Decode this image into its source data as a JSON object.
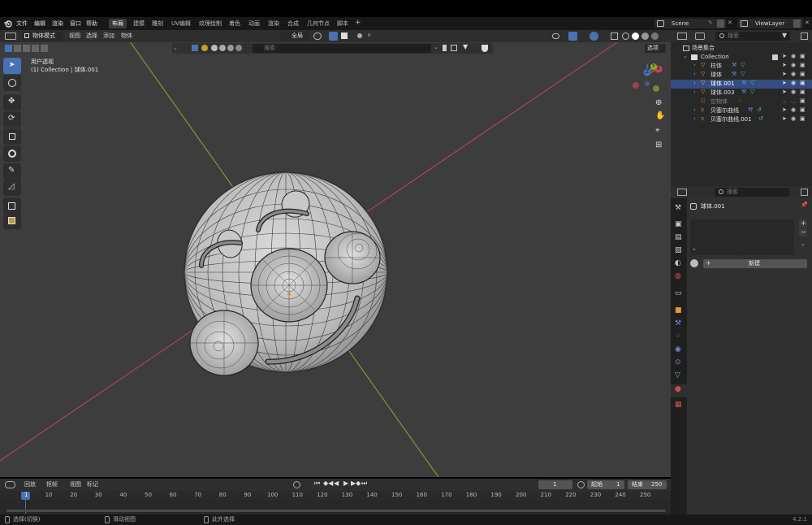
{
  "menu": {
    "items": [
      "文件",
      "编辑",
      "渲染",
      "窗口",
      "帮助"
    ],
    "workspaces": [
      "布局",
      "建模",
      "雕刻",
      "UV编辑",
      "纹理绘制",
      "着色",
      "动画",
      "渲染",
      "合成",
      "几何节点",
      "脚本"
    ],
    "active_workspace": "布局",
    "add_tab": "+",
    "scene": "Scene",
    "view_layer": "ViewLayer"
  },
  "viewport": {
    "mode": "物体模式",
    "menus": [
      "视图",
      "选择",
      "添加",
      "物体"
    ],
    "transform_orientation": "全局",
    "search_placeholder": "搜索",
    "options_label": "选项",
    "view_label": "用户透视",
    "collection_label": "(1) Collection | 球体.001",
    "gizmo": {
      "x": "X",
      "y": "Y",
      "z": "Z"
    },
    "colors": {
      "x_axis": "#c04858",
      "y_axis": "#8fa632",
      "active": "#4772b3"
    }
  },
  "outliner": {
    "search_placeholder": "搜索",
    "root": "场景集合",
    "collection": "Collection",
    "items": [
      {
        "name": "柱体",
        "selected": false
      },
      {
        "name": "球体",
        "selected": false
      },
      {
        "name": "球体.001",
        "selected": true
      },
      {
        "name": "球体.003",
        "selected": false
      },
      {
        "name": "空物体",
        "selected": false
      },
      {
        "name": "贝塞尔曲线",
        "selected": false
      },
      {
        "name": "贝塞尔曲线.001",
        "selected": false
      }
    ]
  },
  "properties": {
    "search_placeholder": "搜索",
    "object_name": "球体.001",
    "new_button": "新建",
    "plus_icon": "+",
    "minus_icon": "−"
  },
  "timeline": {
    "menus": [
      "回放",
      "抠帧",
      "视图",
      "标记"
    ],
    "current_frame": "1",
    "start_label": "起始",
    "start_value": "1",
    "end_label": "结束",
    "end_value": "250",
    "ticks": [
      "1",
      "10",
      "20",
      "30",
      "40",
      "50",
      "60",
      "70",
      "80",
      "90",
      "100",
      "110",
      "120",
      "130",
      "140",
      "150",
      "160",
      "170",
      "180",
      "190",
      "200",
      "210",
      "220",
      "230",
      "240",
      "250"
    ]
  },
  "status": {
    "select": "选择(切换)",
    "pan": "滑动视图",
    "context": "此外选择",
    "version": "4.2.1"
  }
}
